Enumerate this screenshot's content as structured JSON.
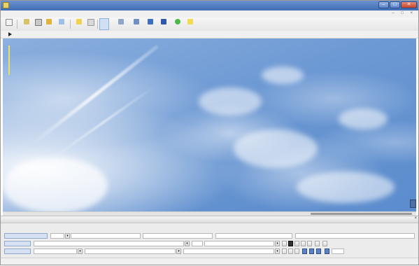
{
  "window": {
    "title": "",
    "minimize_label": "–",
    "maximize_label": "□",
    "close_label": "✕",
    "colors": {
      "titlebar": "#4f7cc0",
      "close": "#d2553a"
    }
  },
  "menu": {
    "items": [
      "",
      "",
      "",
      "",
      "",
      ""
    ],
    "mdi_controls": "– □ ×"
  },
  "toolbar": {
    "buttons": [
      {
        "icon": "new-file-icon",
        "label": ""
      },
      {
        "icon": "open-folder-icon",
        "label": ""
      },
      {
        "icon": "save-icon",
        "label": ""
      },
      {
        "icon": "wand-icon",
        "label": ""
      },
      {
        "icon": "copy-icon",
        "label": ""
      },
      {
        "icon": "folder-icon",
        "label": ""
      },
      {
        "icon": "paste-icon",
        "label": ""
      },
      {
        "icon": "select-icon",
        "label": ""
      },
      {
        "icon": "image-icon",
        "label": ""
      },
      {
        "icon": "chart-icon",
        "label": ""
      },
      {
        "icon": "layers-icon",
        "label": ""
      },
      {
        "icon": "grid-icon",
        "label": ""
      },
      {
        "icon": "green-dot-icon",
        "label": ""
      },
      {
        "icon": "yellow-box-icon",
        "label": ""
      }
    ],
    "right_label": ""
  },
  "subbar": {
    "play_icon": "play-icon"
  },
  "viewport": {
    "image": "blue sky with clouds",
    "scroll_position": 0.8
  },
  "panel": {
    "title": "",
    "close_label": "×",
    "column_headers": [
      "",
      "",
      ""
    ],
    "row1": [
      "",
      "",
      "",
      "",
      ""
    ],
    "row2": [
      "",
      "",
      ""
    ],
    "row3": [
      "",
      "",
      "",
      ""
    ],
    "side_label": ""
  },
  "status": {
    "text": ""
  }
}
